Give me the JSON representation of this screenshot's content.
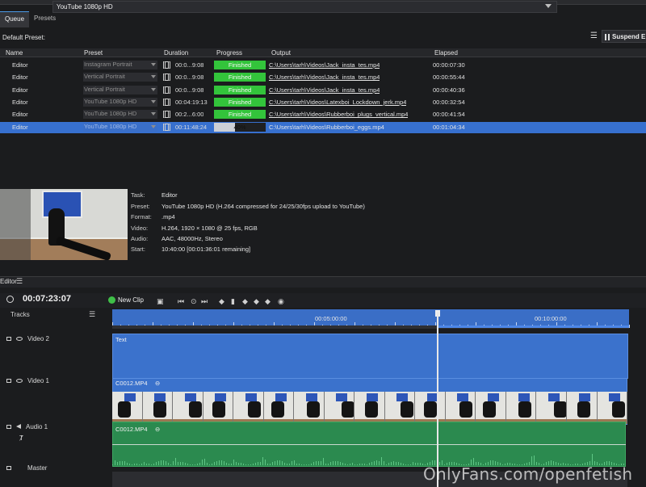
{
  "tabs": [
    {
      "label": "Queue",
      "active": true
    },
    {
      "label": "Presets",
      "active": false
    }
  ],
  "default_preset": {
    "label": "Default Preset:",
    "value": "YouTube 1080p HD"
  },
  "suspend_label": "Suspend E",
  "queue": {
    "columns": {
      "name": "Name",
      "preset": "Preset",
      "duration": "Duration",
      "progress": "Progress",
      "output": "Output",
      "elapsed": "Elapsed"
    },
    "rows": [
      {
        "name": "Editor",
        "preset": "Instagram Portrait",
        "duration": "00:0...9:08",
        "progress_label": "Finished",
        "progress": 1.0,
        "output": "C:\\Users\\tarh\\Videos\\Jack_insta_tes.mp4",
        "elapsed": "00:00:07:30"
      },
      {
        "name": "Editor",
        "preset": "Vertical Portrait",
        "duration": "00:0...9:08",
        "progress_label": "Finished",
        "progress": 1.0,
        "output": "C:\\Users\\tarh\\Videos\\Jack_insta_tes.mp4",
        "elapsed": "00:00:55:44"
      },
      {
        "name": "Editor",
        "preset": "Vertical Portrait",
        "duration": "00:0...9:08",
        "progress_label": "Finished",
        "progress": 1.0,
        "output": "C:\\Users\\tarh\\Videos\\Jack_insta_tes.mp4",
        "elapsed": "00:00:40:36"
      },
      {
        "name": "Editor",
        "preset": "YouTube 1080p HD",
        "duration": "00:04:19:13",
        "progress_label": "Finished",
        "progress": 1.0,
        "output": "C:\\Users\\tarh\\Videos\\Latexboi_Lockdown_jerk.mp4",
        "elapsed": "00:00:32:54"
      },
      {
        "name": "Editor",
        "preset": "YouTube 1080p HD",
        "duration": "00:2...6:00",
        "progress_label": "Finished",
        "progress": 1.0,
        "output": "C:\\Users\\tarh\\Videos\\Rubberboi_plugs_vertical.mp4",
        "elapsed": "00:00:41:54"
      },
      {
        "name": "Editor",
        "preset": "YouTube 1080p HD",
        "duration": "00:11:48:24",
        "progress_label": "40%",
        "progress": 0.4,
        "output": "C:\\Users\\tarh\\Videos\\Rubberboi_eggs.mp4",
        "elapsed": "00:01:04:34",
        "selected": true
      }
    ]
  },
  "details": {
    "task": {
      "label": "Task:",
      "value": "Editor"
    },
    "preset": {
      "label": "Preset:",
      "value": "YouTube 1080p HD (H.264 compressed for 24/25/30fps upload to YouTube)"
    },
    "format": {
      "label": "Format:",
      "value": ".mp4"
    },
    "video": {
      "label": "Video:",
      "value": "H.264, 1920 × 1080 @ 25 fps, RGB"
    },
    "audio": {
      "label": "Audio:",
      "value": "AAC, 48000Hz, Stereo"
    },
    "start": {
      "label": "Start:",
      "value": "10:40:00 [00:01:36:01 remaining]"
    }
  },
  "editor": {
    "title": "Editor",
    "timecode": "00:07:23:07",
    "new_clip": "New Clip",
    "tracks_label": "Tracks",
    "ruler_marks": [
      "00:05:00:00",
      "00:10:00:00"
    ],
    "tracks": [
      {
        "name": "Video 2",
        "clip": "Text"
      },
      {
        "name": "Video 1",
        "clip": "C0012.MP4"
      },
      {
        "name": "Audio 1",
        "clip": "C0012.MP4"
      },
      {
        "name": "Master",
        "clip": ""
      }
    ]
  },
  "watermark": "OnlyFans.com/openfetish",
  "colors": {
    "finished": "#33c43b",
    "selected_row": "#3770cf",
    "video_clip": "#3b72cc",
    "audio_clip": "#2b8a4f"
  }
}
